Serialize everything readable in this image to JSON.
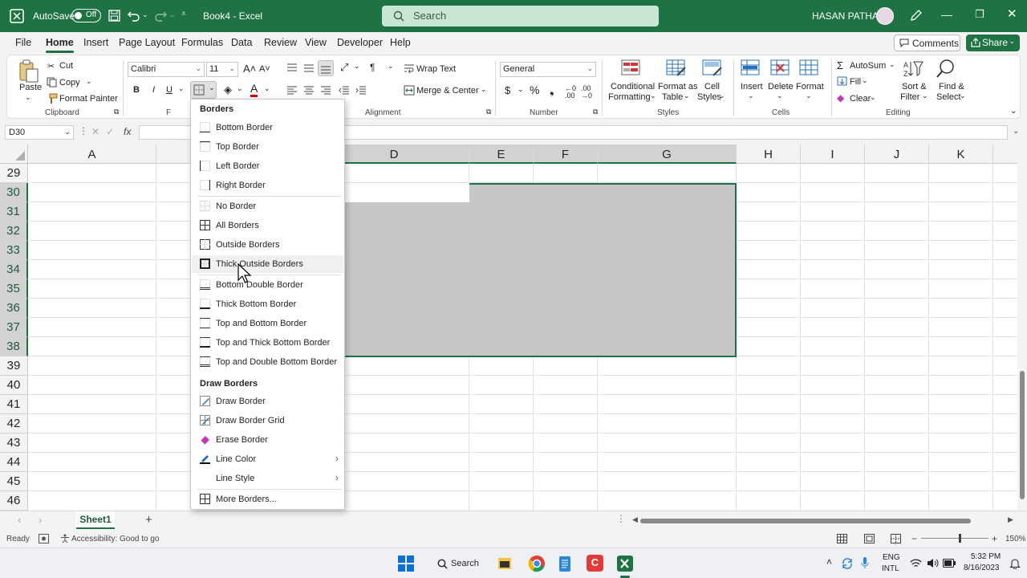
{
  "titlebar": {
    "autosave_label": "AutoSave",
    "autosave_state": "Off",
    "doc_title": "Book4  -  Excel",
    "search_placeholder": "Search",
    "user_name": "HASAN PATHAN",
    "accent_color": "#1f7244"
  },
  "tabs": [
    "File",
    "Home",
    "Insert",
    "Page Layout",
    "Formulas",
    "Data",
    "Review",
    "View",
    "Developer",
    "Help"
  ],
  "active_tab": "Home",
  "actions": {
    "comments": "Comments",
    "share": "Share"
  },
  "ribbon": {
    "clipboard": {
      "paste": "Paste",
      "cut": "Cut",
      "copy": "Copy",
      "format_painter": "Format Painter",
      "label": "Clipboard"
    },
    "font": {
      "family": "Calibri",
      "size": "11",
      "bold": "B",
      "italic": "I",
      "underline": "U",
      "label": "F"
    },
    "alignment": {
      "wrap_text": "Wrap Text",
      "merge_center": "Merge & Center",
      "label": "Alignment"
    },
    "number": {
      "format": "General",
      "label": "Number"
    },
    "styles": {
      "conditional_1": "Conditional",
      "conditional_2": "Formatting",
      "format_table_1": "Format as",
      "format_table_2": "Table",
      "cell_styles_1": "Cell",
      "cell_styles_2": "Styles",
      "label": "Styles"
    },
    "cells": {
      "insert": "Insert",
      "delete": "Delete",
      "format": "Format",
      "label": "Cells"
    },
    "editing": {
      "autosum": "AutoSum",
      "fill": "Fill",
      "clear": "Clear",
      "sort_1": "Sort &",
      "sort_2": "Filter",
      "find_1": "Find &",
      "find_2": "Select",
      "label": "Editing"
    }
  },
  "formula_bar": {
    "name_box": "D30",
    "fx": "fx"
  },
  "grid": {
    "columns": [
      "A",
      "D",
      "E",
      "F",
      "G",
      "H",
      "I",
      "J",
      "K"
    ],
    "rows": [
      "29",
      "30",
      "31",
      "32",
      "33",
      "34",
      "35",
      "36",
      "37",
      "38",
      "39",
      "40",
      "41",
      "42",
      "43",
      "44",
      "45",
      "46"
    ],
    "selection_fill": "#c8c6c8"
  },
  "menu": {
    "heading_borders": "Borders",
    "items_borders": [
      "Bottom Border",
      "Top Border",
      "Left Border",
      "Right Border",
      "No Border",
      "All Borders",
      "Outside Borders",
      "Thick Outside Borders",
      "Bottom Double Border",
      "Thick Bottom Border",
      "Top and Bottom Border",
      "Top and Thick Bottom Border",
      "Top and Double Bottom Border"
    ],
    "heading_draw": "Draw Borders",
    "items_draw": [
      "Draw Border",
      "Draw Border Grid",
      "Erase Border",
      "Line Color",
      "Line Style",
      "More Borders..."
    ],
    "hovered": "Thick Outside Borders"
  },
  "sheets": {
    "active": "Sheet1",
    "add": "+"
  },
  "status": {
    "ready": "Ready",
    "accessibility": "Accessibility: Good to go",
    "zoom": "150%"
  },
  "taskbar": {
    "search": "Search",
    "lang_1": "ENG",
    "lang_2": "INTL",
    "time": "5:32 PM",
    "date": "8/16/2023"
  }
}
